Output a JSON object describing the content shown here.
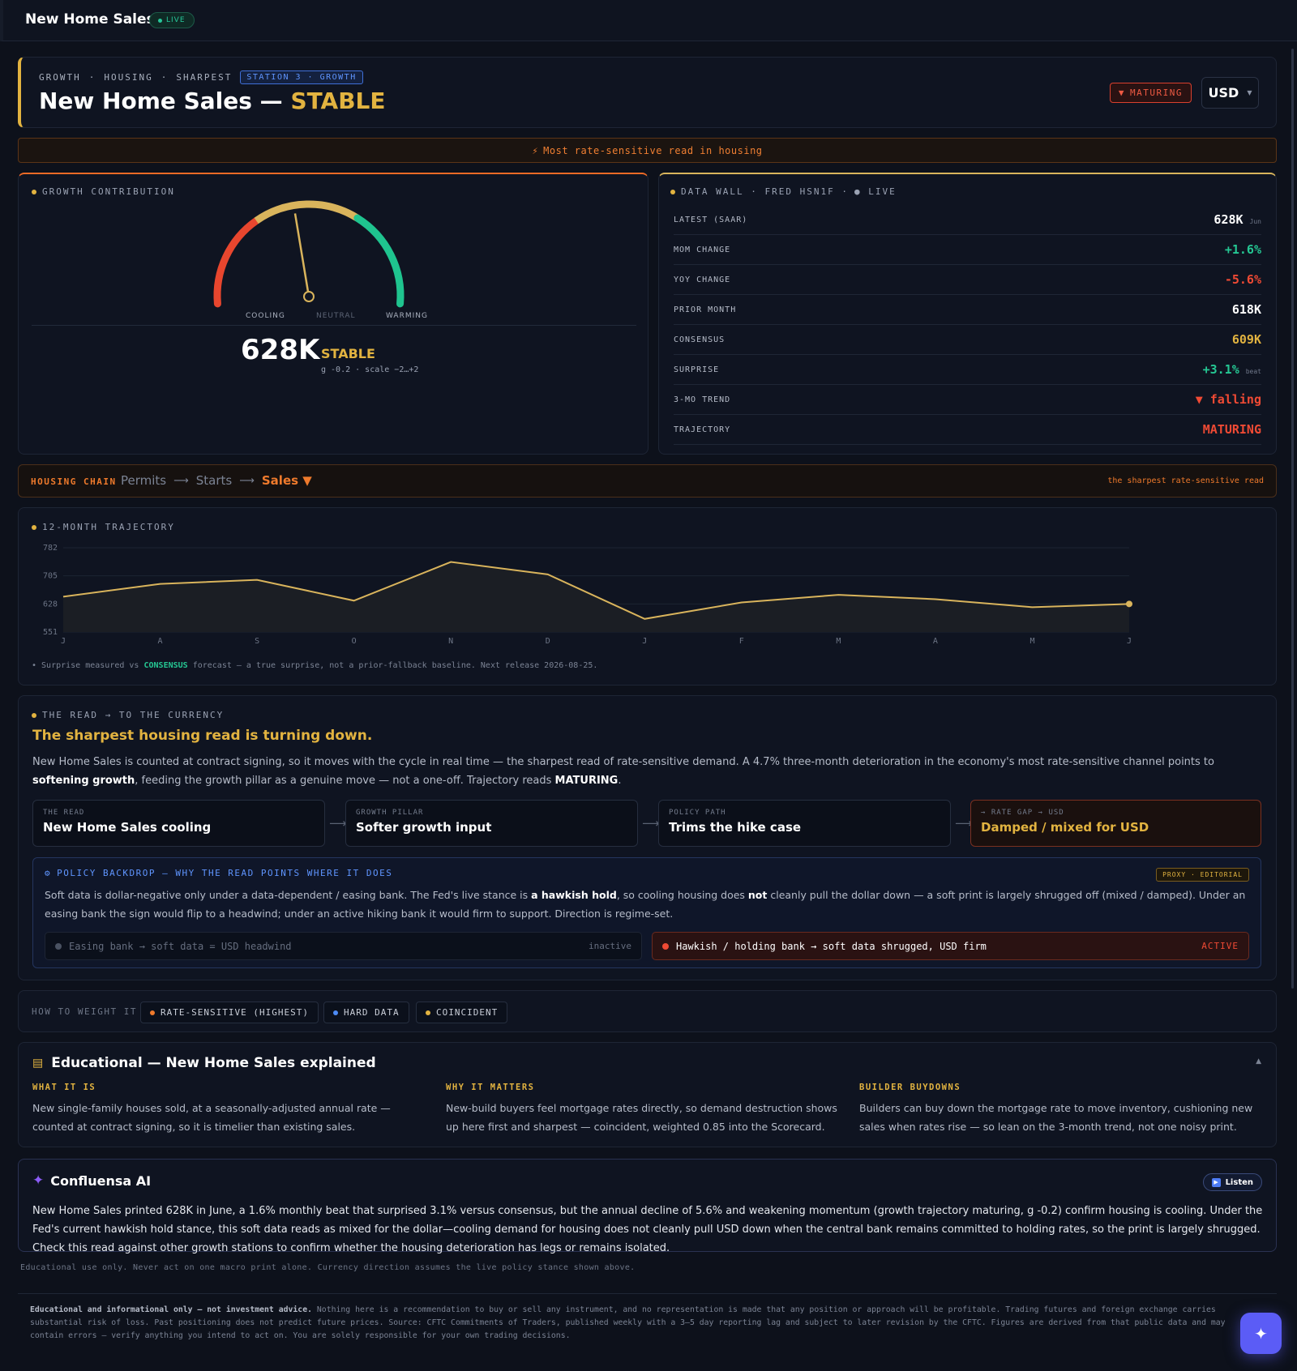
{
  "topbar": {
    "title": "New Home Sales",
    "live": "LIVE"
  },
  "header": {
    "crumb": [
      "GROWTH",
      "HOUSING",
      "SHARPEST"
    ],
    "station": "STATION 3 · GROWTH",
    "title": "New Home Sales —",
    "state": "STABLE",
    "badge": "MATURING",
    "currency": "USD"
  },
  "banner": {
    "icon": "⚡",
    "text": "Most rate-sensitive read in housing"
  },
  "gauge": {
    "label": "GROWTH CONTRIBUTION",
    "value": "628K",
    "state": "STABLE",
    "sub": "g -0.2 · scale −2…+2",
    "labels": [
      "COOLING",
      "NEUTRAL",
      "WARMING"
    ],
    "needle_g": -0.2,
    "scale": [
      -2,
      2
    ],
    "colors": {
      "cool": "#e8462e",
      "neutral": "#d9b45c",
      "warm": "#1fc48f"
    }
  },
  "wall": {
    "label": "DATA WALL · FRED HSN1F ·",
    "live": "● LIVE",
    "rows": [
      {
        "k": "LATEST (SAAR)",
        "v": "628K",
        "note": "Jun",
        "cls": ""
      },
      {
        "k": "MOM CHANGE",
        "v": "+1.6%",
        "note": "",
        "cls": "green"
      },
      {
        "k": "YOY CHANGE",
        "v": "-5.6%",
        "note": "",
        "cls": "red"
      },
      {
        "k": "PRIOR MONTH",
        "v": "618K",
        "note": "",
        "cls": ""
      },
      {
        "k": "CONSENSUS",
        "v": "609K",
        "note": "",
        "cls": "gold"
      },
      {
        "k": "SURPRISE",
        "v": "+3.1%",
        "note": "beat",
        "cls": "green"
      },
      {
        "k": "3-MO TREND",
        "v": "▼ falling",
        "note": "",
        "cls": "red"
      },
      {
        "k": "TRAJECTORY",
        "v": "MATURING",
        "note": "",
        "cls": "red"
      }
    ]
  },
  "chain": {
    "label": "HOUSING CHAIN",
    "steps": [
      "Permits",
      "Starts",
      "Sales ▼"
    ],
    "right": "the sharpest rate-sensitive read"
  },
  "chart_data": {
    "type": "area",
    "title": "12-MONTH TRAJECTORY",
    "x": [
      "J",
      "A",
      "S",
      "O",
      "N",
      "D",
      "J",
      "F",
      "M",
      "A",
      "M",
      "J"
    ],
    "series": [
      {
        "values": [
          648,
          683,
          694,
          637,
          743,
          709,
          587,
          632,
          653,
          641,
          619,
          628
        ]
      }
    ],
    "yticks": [
      782,
      705,
      628,
      551
    ],
    "ylim": [
      551,
      782
    ],
    "grid": true
  },
  "traj": {
    "note_pre": "• Surprise measured vs ",
    "note_hl": "CONSENSUS",
    "note_post": " forecast — a true surprise, not a prior-fallback baseline. Next release 2026-08-25."
  },
  "read": {
    "label": "THE READ → TO THE CURRENCY",
    "headline": "The sharpest housing read is turning down.",
    "p1": "New Home Sales is counted at contract signing, so it moves with the cycle in real time — the sharpest read of rate-sensitive demand. A 4.7% three-month deterioration in the economy's most rate-sensitive channel points to ",
    "p1b": "softening growth",
    "p1c": ", feeding the growth pillar as a genuine move — not a one-off. Trajectory reads ",
    "p1d": "MATURING",
    "p1e": ".",
    "boxes": [
      {
        "t": "THE READ",
        "v": "New Home Sales cooling"
      },
      {
        "t": "GROWTH PILLAR",
        "v": "Softer growth input"
      },
      {
        "t": "POLICY PATH",
        "v": "Trims the hike case"
      },
      {
        "t": "→ RATE GAP → USD",
        "v": "Damped / mixed for USD"
      }
    ]
  },
  "policy": {
    "title": "POLICY BACKDROP — WHY THE READ POINTS WHERE IT DOES",
    "tag": "PROXY · EDITORIAL",
    "p1": "Soft data is dollar-negative only under a data-dependent / easing bank. The Fed's live stance is ",
    "p2": "a hawkish hold",
    "p3": ", so cooling housing does ",
    "p4": "not",
    "p5": " cleanly pull the dollar down — a soft print is largely shrugged off (mixed / damped). Under an easing bank the sign would flip to a headwind; under an active hiking bank it would firm to support. Direction is regime-set.",
    "opt_off": "Easing bank → soft data = USD headwind",
    "opt_off_s": "inactive",
    "opt_on": "Hawkish / holding bank → soft data shrugged, USD firm",
    "opt_on_s": "ACTIVE"
  },
  "weight": {
    "label": "HOW TO WEIGHT IT",
    "chips": [
      "RATE-SENSITIVE (HIGHEST)",
      "HARD DATA",
      "COINCIDENT"
    ]
  },
  "edu": {
    "title": "Educational — New Home Sales explained",
    "cols": [
      {
        "h": "WHAT IT IS",
        "b": "New single-family houses sold, at a seasonally-adjusted annual rate — counted at contract signing, so it is timelier than existing sales."
      },
      {
        "h": "WHY IT MATTERS",
        "b": "New-build buyers feel mortgage rates directly, so demand destruction shows up here first and sharpest — coincident, weighted 0.85 into the Scorecard."
      },
      {
        "h": "BUILDER BUYDOWNS",
        "b": "Builders can buy down the mortgage rate to move inventory, cushioning new sales when rates rise — so lean on the 3-month trend, not one noisy print."
      }
    ]
  },
  "ai": {
    "title": "Confluensa AI",
    "listen": "Listen",
    "body": "New Home Sales printed 628K in June, a 1.6% monthly beat that surprised 3.1% versus consensus, but the annual decline of 5.6% and weakening momentum (growth trajectory maturing, g -0.2) confirm housing is cooling. Under the Fed's current hawkish hold stance, this soft data reads as mixed for the dollar—cooling demand for housing does not cleanly pull USD down when the central bank remains committed to holding rates, so the print is largely shrugged. Check this read against other growth stations to confirm whether the housing deterioration has legs or remains isolated."
  },
  "edu_note": "Educational use only. Never act on one macro print alone. Currency direction assumes the live policy stance shown above.",
  "footer": {
    "bold": "Educational and informational only — not investment advice.",
    "text": " Nothing here is a recommendation to buy or sell any instrument, and no representation is made that any position or approach will be profitable. Trading futures and foreign exchange carries substantial risk of loss. Past positioning does not predict future prices. Source: CFTC Commitments of Traders, published weekly with a 3–5 day reporting lag and subject to later revision by the CFTC. Figures are derived from that public data and may contain errors — verify anything you intend to act on. You are solely responsible for your own trading decisions."
  },
  "fab": "✦"
}
